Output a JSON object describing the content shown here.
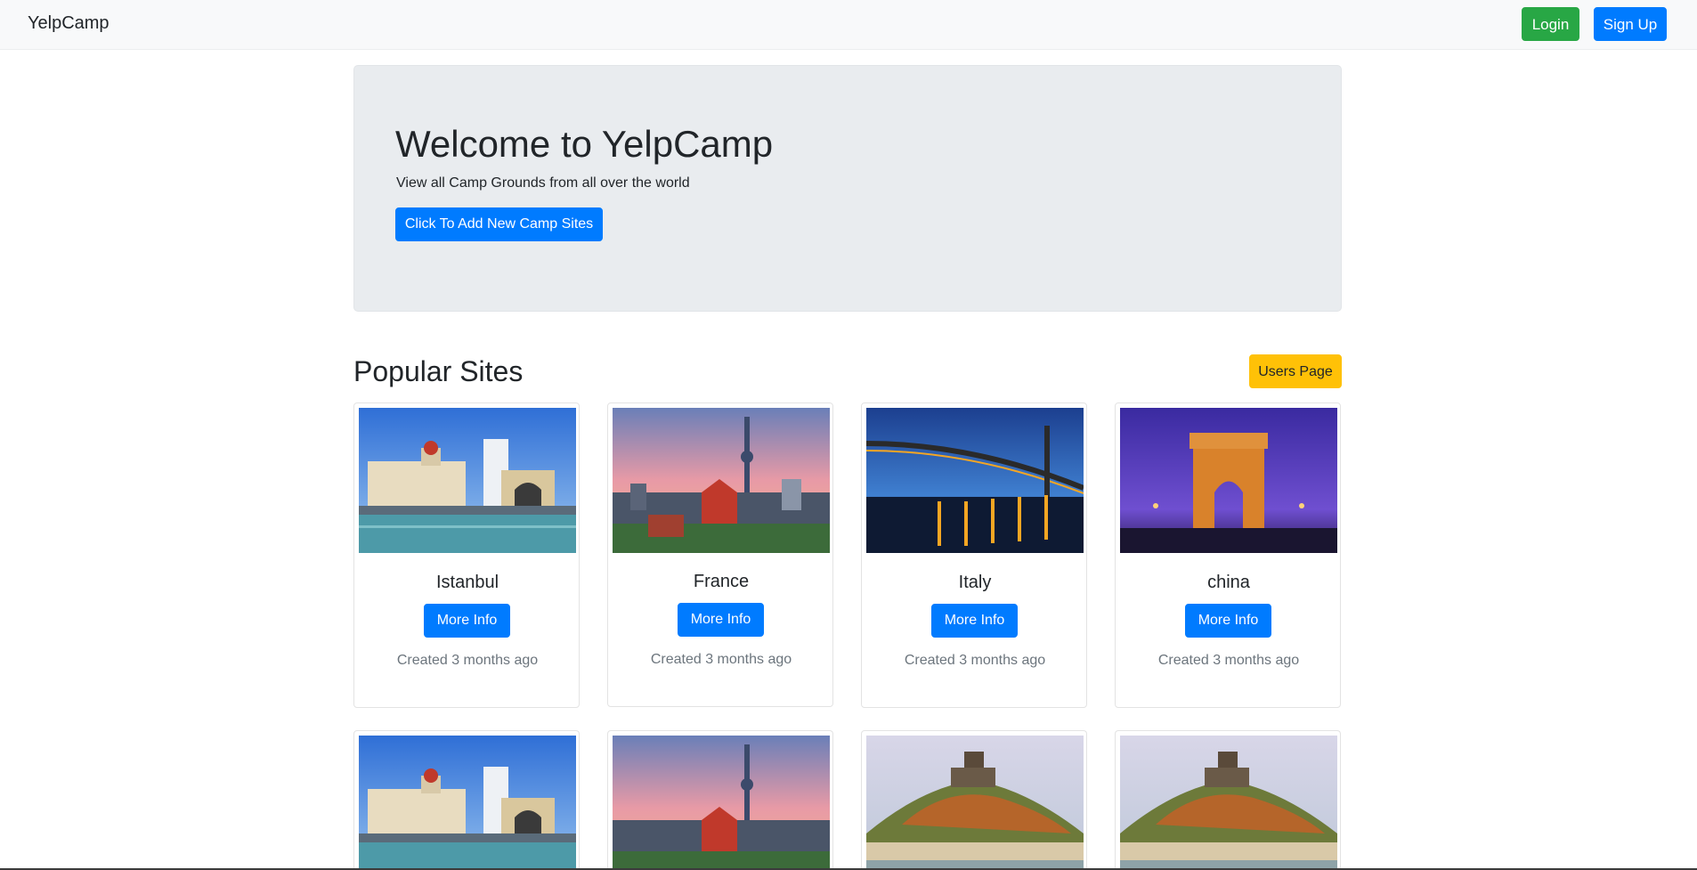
{
  "navbar": {
    "brand": "YelpCamp",
    "login_label": "Login",
    "signup_label": "Sign Up"
  },
  "jumbotron": {
    "title": "Welcome to YelpCamp",
    "subtitle": "View all Camp Grounds from all over the world",
    "add_button_label": "Click To Add New Camp Sites"
  },
  "section": {
    "title": "Popular Sites",
    "users_button_label": "Users Page"
  },
  "cards": [
    {
      "title": "Istanbul",
      "button_label": "More Info",
      "created": "Created 3 months ago",
      "image": "gateway-harbor-photo"
    },
    {
      "title": "France",
      "button_label": "More Info",
      "created": "Created 3 months ago",
      "image": "city-tower-sunset-photo"
    },
    {
      "title": "Italy",
      "button_label": "More Info",
      "created": "Created 3 months ago",
      "image": "bridge-night-photo"
    },
    {
      "title": "china",
      "button_label": "More Info",
      "created": "Created 3 months ago",
      "image": "arch-monument-dusk-photo"
    }
  ],
  "second_row_images": [
    "gateway-harbor-photo",
    "city-tower-sunset-photo",
    "castle-river-town-photo",
    "castle-river-town-photo"
  ],
  "colors": {
    "primary": "#007bff",
    "success": "#28a745",
    "warning": "#ffc107",
    "jumbotron_bg": "#e9ecef",
    "navbar_bg": "#f8f9fa"
  }
}
